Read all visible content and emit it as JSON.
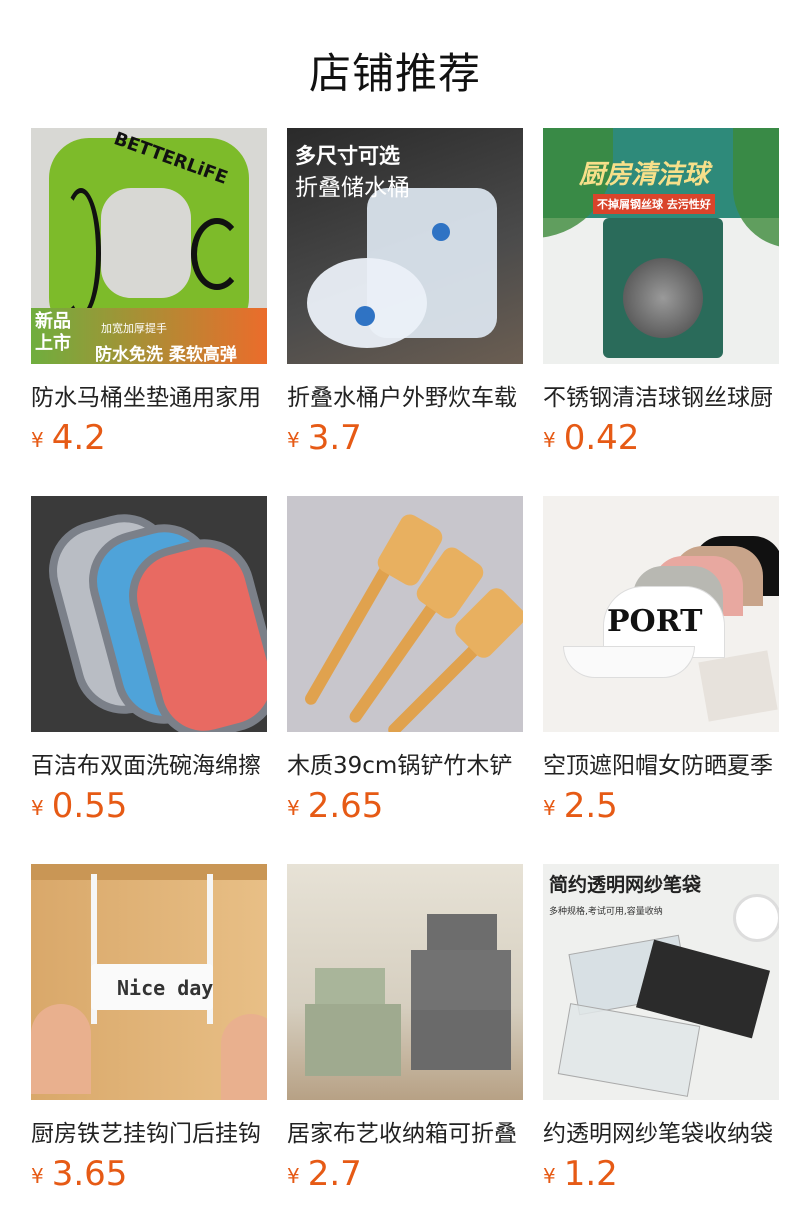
{
  "page": {
    "title": "店铺推荐"
  },
  "currency_symbol": "¥",
  "products": [
    {
      "name": "防水马桶坐垫通用家用",
      "price": "4.2",
      "overlay": {
        "brand": "BETTERLiFE",
        "badge_new": "新品上市",
        "sub": "加宽加厚提手",
        "slogan": "防水免洗 柔软高弹"
      }
    },
    {
      "name": "折叠水桶户外野炊车载",
      "price": "3.7",
      "overlay": {
        "line1": "多尺寸可选",
        "line2": "折叠储水桶"
      }
    },
    {
      "name": "不锈钢清洁球钢丝球厨",
      "price": "0.42",
      "overlay": {
        "line1": "厨房清洁球",
        "line2": "不掉屑钢丝球 去污性好"
      }
    },
    {
      "name": "百洁布双面洗碗海绵擦",
      "price": "0.55"
    },
    {
      "name": "木质39cm锅铲竹木铲",
      "price": "2.65"
    },
    {
      "name": "空顶遮阳帽女防晒夏季",
      "price": "2.5",
      "overlay": {
        "line1": "PORT"
      }
    },
    {
      "name": "厨房铁艺挂钩门后挂钩",
      "price": "3.65",
      "overlay": {
        "line1": "Nice day"
      }
    },
    {
      "name": "居家布艺收纳箱可折叠",
      "price": "2.7"
    },
    {
      "name": "约透明网纱笔袋收纳袋",
      "price": "1.2",
      "overlay": {
        "line1": "简约透明网纱笔袋",
        "line2": "多种规格,考试可用,容量收纳"
      }
    }
  ]
}
